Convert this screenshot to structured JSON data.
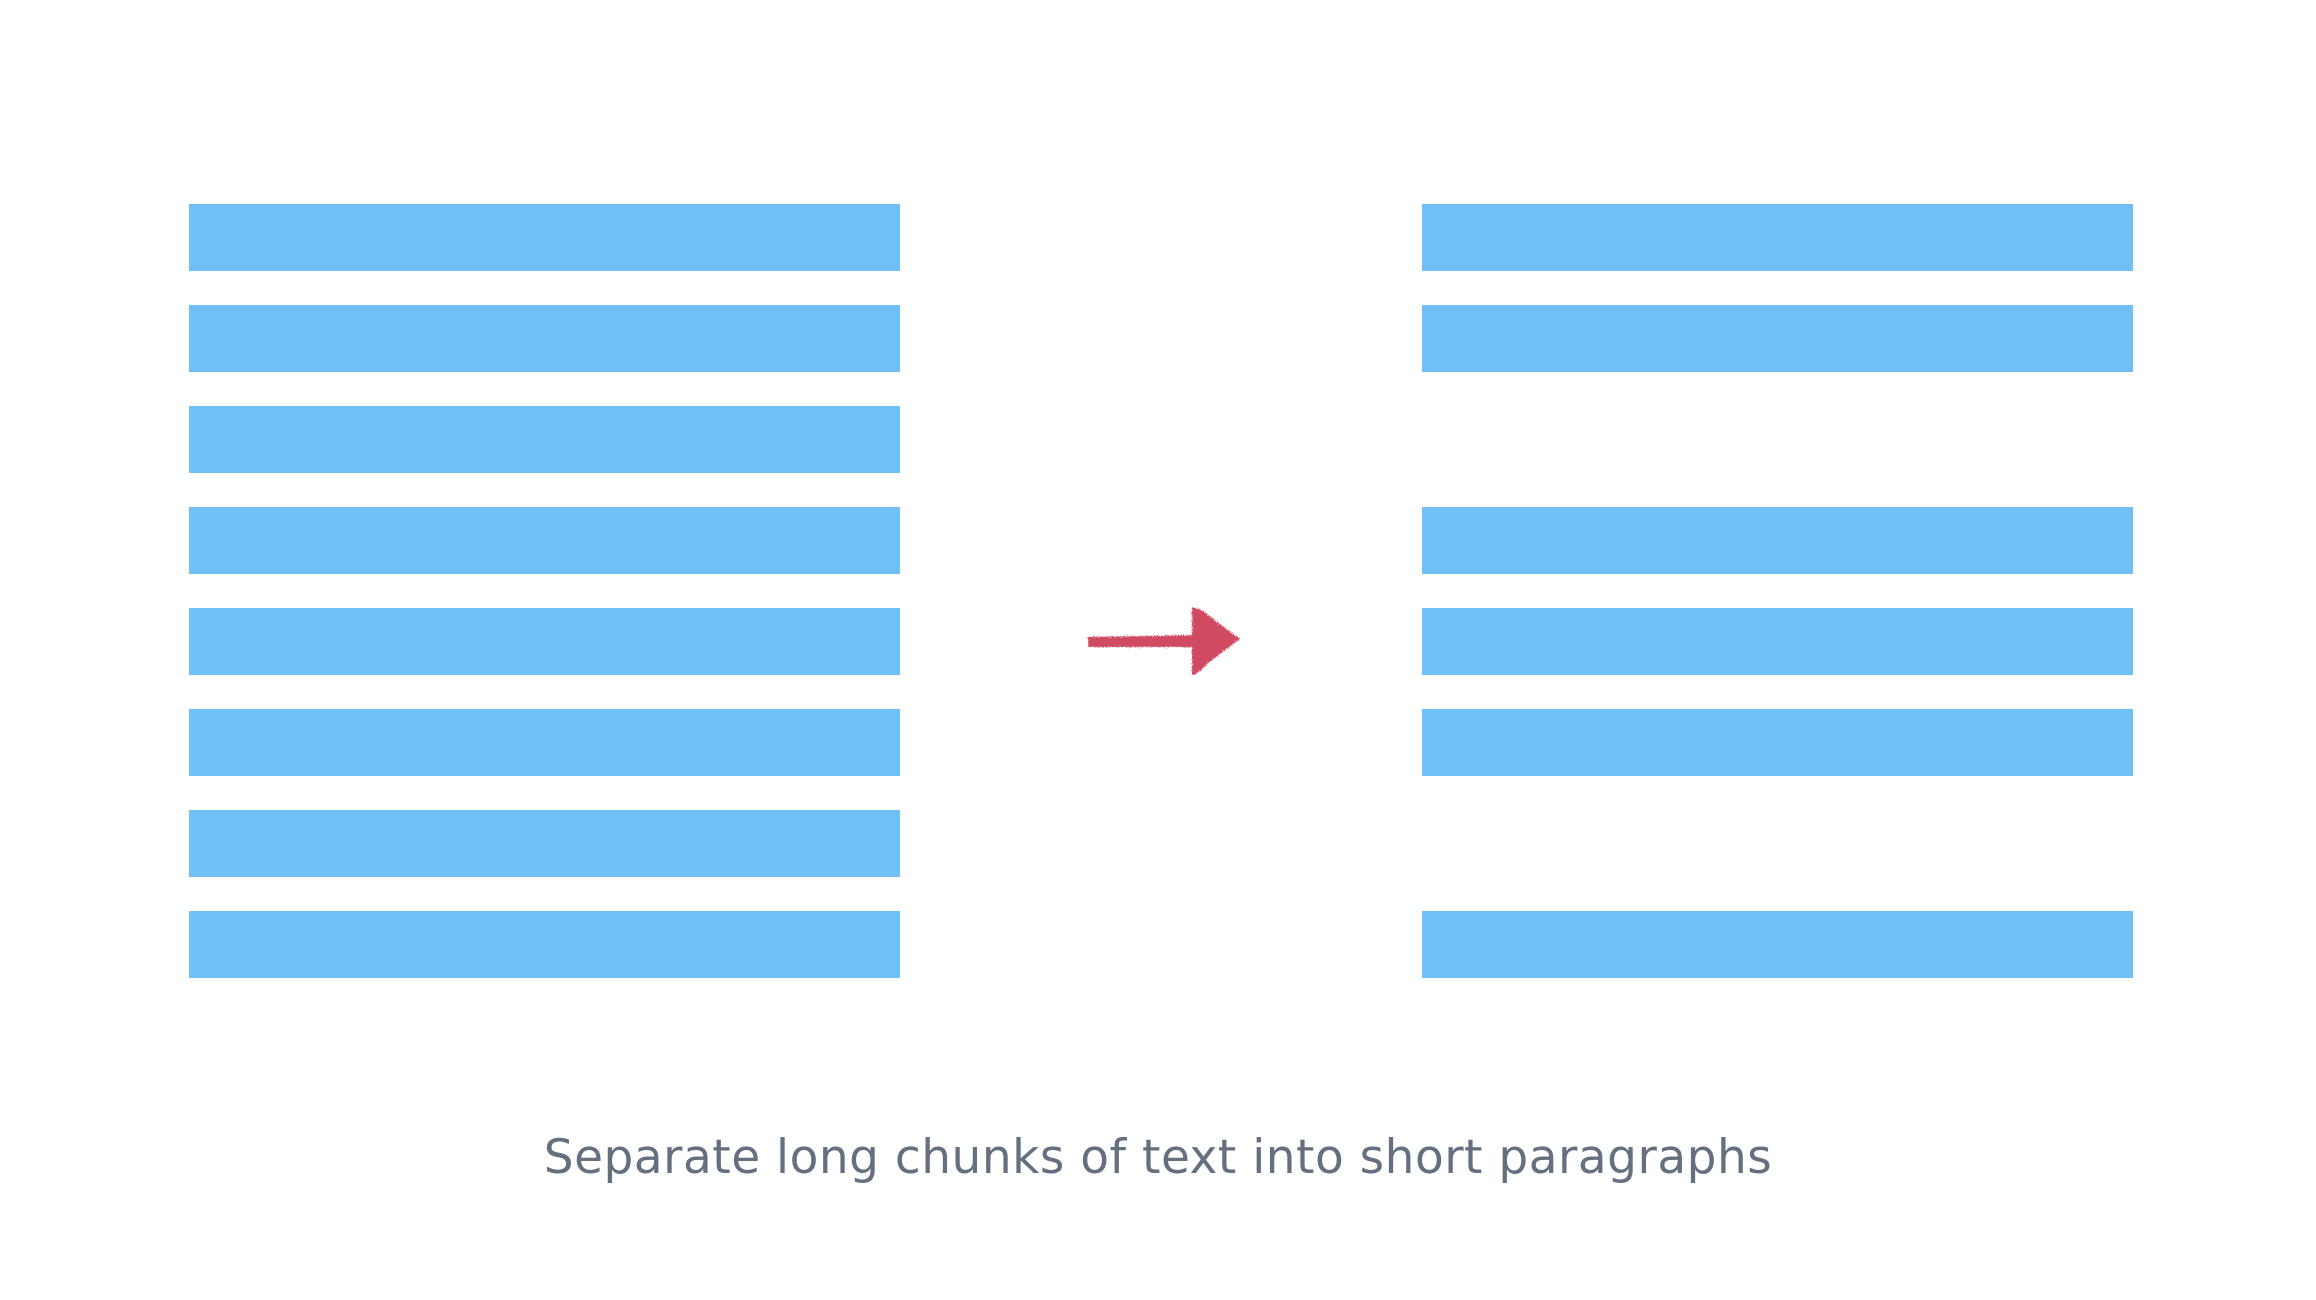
{
  "colors": {
    "background": "#ffffff",
    "bar": "#70c0f8",
    "arrow": "#d04c62",
    "caption": "#64707f"
  },
  "before": {
    "lines": [
      true,
      true,
      true,
      true,
      true,
      true,
      true,
      true
    ]
  },
  "after": {
    "lines": [
      true,
      true,
      false,
      true,
      true,
      true,
      false,
      true
    ]
  },
  "arrow_icon": "right-arrow-icon",
  "caption": "Separate long chunks of text into short paragraphs"
}
